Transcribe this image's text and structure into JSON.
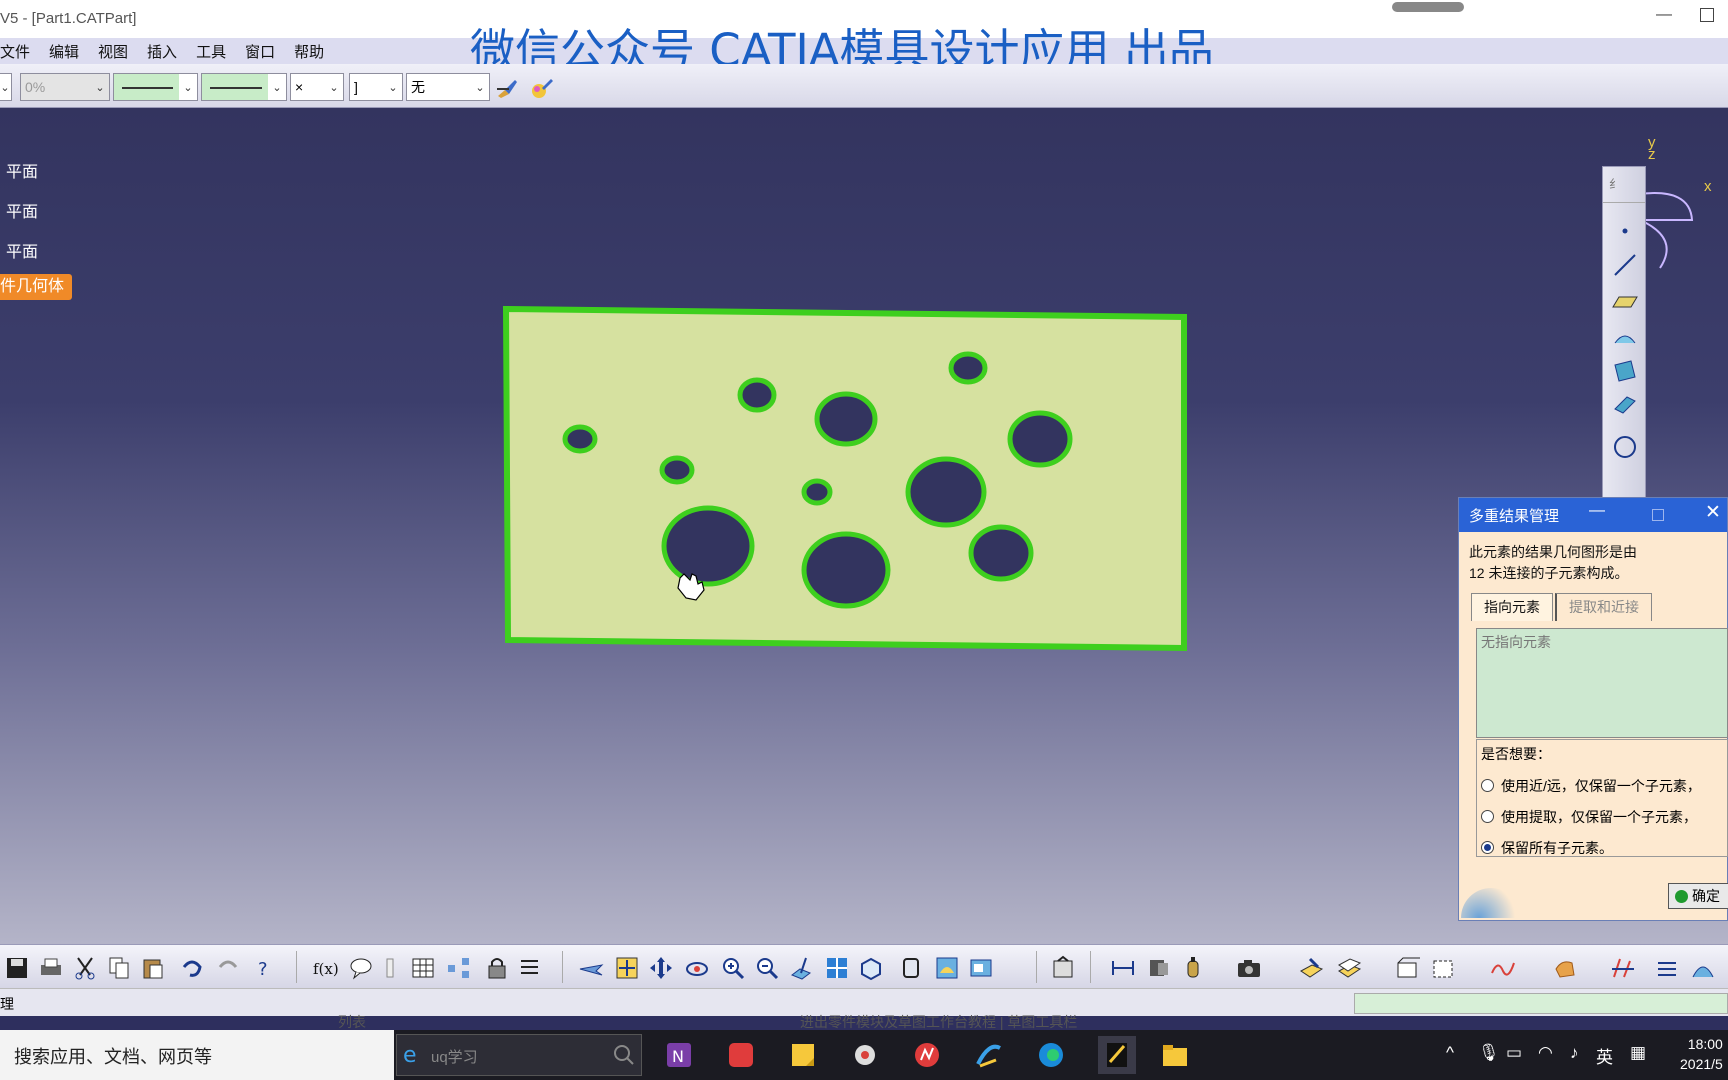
{
  "window": {
    "title": "V5 - [Part1.CATPart]"
  },
  "watermark": "微信公众号 CATIA模具设计应用 出品",
  "menu": [
    "文件",
    "编辑",
    "视图",
    "插入",
    "工具",
    "窗口",
    "帮助"
  ],
  "toolbar_top": {
    "transparency_value": "0%",
    "point_value": "无",
    "layer_value": "]",
    "x_value": "×"
  },
  "tree": {
    "items": [
      "平面",
      "平面",
      "平面"
    ],
    "highlight": "件几何体"
  },
  "axis": {
    "x": "x",
    "y": "y",
    "z": "z"
  },
  "vtoolbar_head": "纟",
  "dialog": {
    "title": "多重结果管理",
    "message_line1": "此元素的结果几何图形是由",
    "message_line2": "12 未连接的子元素构成。",
    "tab_active": "指向元素",
    "tab_inactive": "提取和近接",
    "list_placeholder": "无指向元素",
    "question": "是否想要：",
    "options": [
      {
        "label": "使用近/远，仅保留一个子元素，",
        "checked": false
      },
      {
        "label": "使用提取，仅保留一个子元素，",
        "checked": false
      },
      {
        "label": "保留所有子元素。",
        "checked": true
      }
    ],
    "ok_label": "确定"
  },
  "statusbar": {
    "text": "理",
    "underlay_left": "列表",
    "underlay_mid": "进出零件模块及草图工作台教程 | 草图工具栏"
  },
  "taskbar": {
    "search_placeholder": "搜索应用、文档、网页等",
    "app_search": "uq学习",
    "ime": "英",
    "time": "18:00",
    "date": "2021/5"
  },
  "colors": {
    "part_fill": "#d6e1a0",
    "part_edge": "#3ecf1e",
    "dialog_title": "#2a63d6",
    "tree_highlight": "#f08a28"
  }
}
